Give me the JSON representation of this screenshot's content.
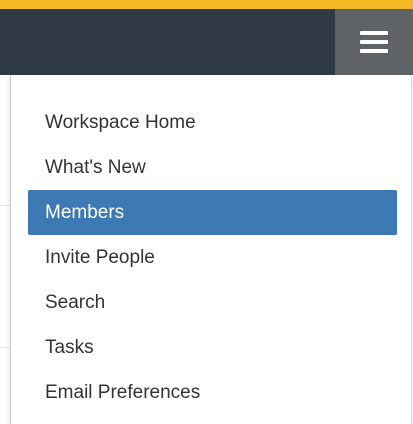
{
  "colors": {
    "accent": "#f4b824",
    "topbar": "#2f3a45",
    "menu_toggle": "#5f6366",
    "active_item": "#3d7ab3"
  },
  "header": {
    "menu_toggle_icon": "hamburger-menu-icon"
  },
  "menu": {
    "active_index": 2,
    "items": [
      {
        "label": "Workspace Home"
      },
      {
        "label": "What's New"
      },
      {
        "label": "Members"
      },
      {
        "label": "Invite People"
      },
      {
        "label": "Search"
      },
      {
        "label": "Tasks"
      },
      {
        "label": "Email Preferences"
      }
    ]
  }
}
